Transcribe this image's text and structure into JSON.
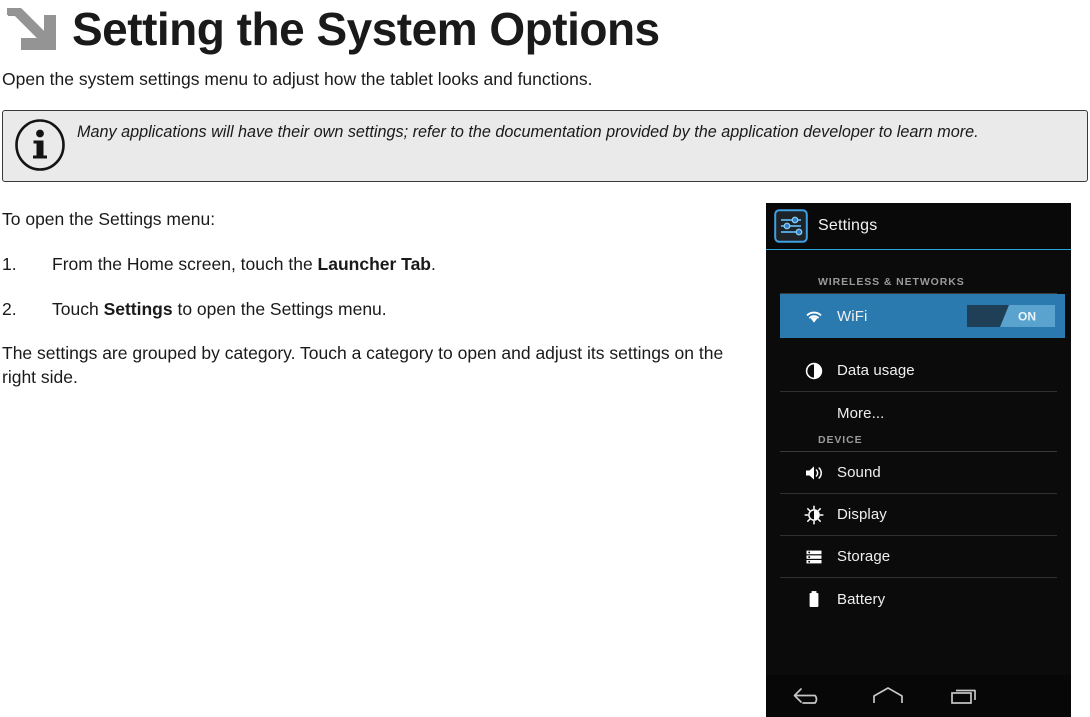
{
  "header": {
    "arrow_icon": "arrow-down-right-icon",
    "title": "Setting the System Options",
    "intro": "Open the system settings menu to adjust how the tablet looks and functions."
  },
  "note": {
    "icon": "info-icon",
    "text": "Many applications will have their own settings; refer to the documentation provided by the application developer to learn more."
  },
  "body": {
    "lead": "To open the Settings menu:",
    "steps": [
      {
        "number": "1.",
        "prefix": "From the Home screen, touch the ",
        "bold": "Launcher Tab",
        "suffix": "."
      },
      {
        "number": "2.",
        "prefix": "Touch ",
        "bold": "Settings",
        "suffix": " to open the Settings menu."
      }
    ],
    "closing": "The settings are grouped by category. Touch a category to open and adjust its settings on the right side."
  },
  "device_screenshot": {
    "header": {
      "icon": "settings-sliders-icon",
      "title": "Settings"
    },
    "sections": [
      {
        "label": "WIRELESS & NETWORKS",
        "items": [
          {
            "icon": "wifi-icon",
            "label": "WiFi",
            "selected": true,
            "toggle": "ON"
          },
          {
            "icon": "data-usage-icon",
            "label": "Data usage",
            "selected": false
          },
          {
            "icon": "none",
            "label": "More...",
            "selected": false
          }
        ]
      },
      {
        "label": "DEVICE",
        "items": [
          {
            "icon": "sound-icon",
            "label": "Sound",
            "selected": false
          },
          {
            "icon": "display-brightness-icon",
            "label": "Display",
            "selected": false
          },
          {
            "icon": "storage-icon",
            "label": "Storage",
            "selected": false
          },
          {
            "icon": "battery-icon",
            "label": "Battery",
            "selected": false
          }
        ]
      }
    ],
    "navbar": [
      {
        "icon": "back-icon"
      },
      {
        "icon": "home-icon"
      },
      {
        "icon": "recents-icon"
      }
    ],
    "colors": {
      "accent_blue": "#2aa3d8",
      "selected_row": "#2a7ab0",
      "background": "#0b0b0b"
    }
  }
}
